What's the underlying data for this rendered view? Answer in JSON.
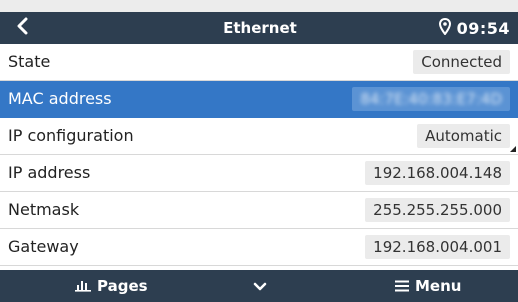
{
  "header": {
    "back_icon": "chevron-left-icon",
    "title": "Ethernet",
    "location_icon": "location-pin-icon",
    "time": "09:54"
  },
  "rows": [
    {
      "label": "State",
      "value": "Connected"
    },
    {
      "label": "MAC address",
      "value": "84:7E:40:83:E7:4D"
    },
    {
      "label": "IP configuration",
      "value": "Automatic"
    },
    {
      "label": "IP address",
      "value": "192.168.004.148"
    },
    {
      "label": "Netmask",
      "value": "255.255.255.000"
    },
    {
      "label": "Gateway",
      "value": "192.168.004.001"
    }
  ],
  "footer": {
    "pages_icon": "bar-chart-icon",
    "pages_label": "Pages",
    "middle_icon": "chevron-down-icon",
    "menu_icon": "hamburger-icon",
    "menu_label": "Menu"
  },
  "colors": {
    "bar_background": "#2d3e50",
    "selected_row": "#3477c6",
    "value_box": "#ebebeb"
  }
}
